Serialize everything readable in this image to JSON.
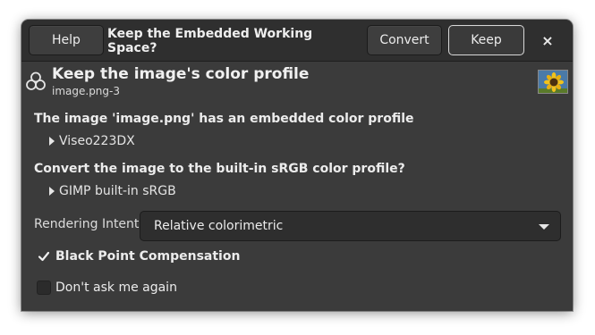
{
  "header": {
    "help_label": "Help",
    "title": "Keep the Embedded Working Space?",
    "convert_label": "Convert",
    "keep_label": "Keep",
    "close_glyph": "×"
  },
  "profile": {
    "icon": "color-profile-icon",
    "heading": "Keep the image's color profile",
    "subheading": "image.png-3",
    "thumbnail": "sunflower-thumbnail"
  },
  "embedded": {
    "label": "The image 'image.png' has an embedded color profile",
    "profile_name": "Viseo223DX"
  },
  "builtin": {
    "label": "Convert the image to the built-in sRGB color profile?",
    "profile_name": "GIMP built-in sRGB"
  },
  "rendering_intent": {
    "label": "Rendering Intent:",
    "selected": "Relative colorimetric"
  },
  "black_point": {
    "label": "Black Point Compensation",
    "checked": true
  },
  "dont_ask": {
    "label": "Don't ask me again",
    "checked": false
  },
  "colors": {
    "dialog_bg": "#3b3b3b",
    "headerbar_bg": "#2f2f2f",
    "text": "#e8e8e8",
    "keep_border": "#d8d8d8"
  }
}
